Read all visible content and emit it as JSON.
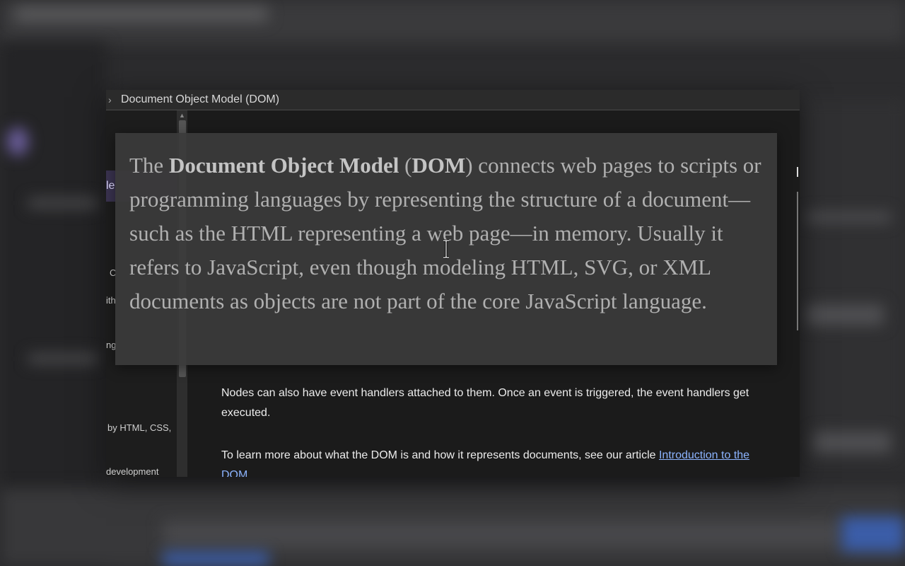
{
  "window": {
    "title": "Document Object Model (DOM)"
  },
  "sidebar": {
    "active_item": "le",
    "lines": [
      "C",
      "ith",
      "ng",
      "by HTML, CSS,",
      "development"
    ]
  },
  "content": {
    "para_events": "Nodes can also have event handlers attached to them. Once an event is triggered, the event handlers get executed.",
    "para_learn_prefix": "To learn more about what the DOM is and how it represents documents, see our article ",
    "para_learn_link": "Introduction to the DOM",
    "para_learn_suffix": "."
  },
  "tooltip": {
    "text_1": "The ",
    "bold_1": "Document Object Model",
    "text_2": " (",
    "bold_2": "DOM",
    "text_3": ") connects web pages to scripts or programming languages by representing the structure of a document—such as the HTML representing a web page—in memory. Usually it refers to JavaScript, even though modeling HTML, SVG, or XML documents as objects are not part of the core JavaScript language."
  },
  "icons": {
    "title_chevron": "chevron-right-icon",
    "scroll_up": "scroll-up-arrow-icon",
    "cursor": "text-cursor-icon"
  },
  "colors": {
    "window_bg": "#1b1b1b",
    "titlebar_bg": "#2b2b2b",
    "link": "#8cb4ff",
    "sidebar_active": "#3a3350",
    "tooltip_bg": "#3a3a3a",
    "tooltip_text": "#b0b0b0"
  }
}
